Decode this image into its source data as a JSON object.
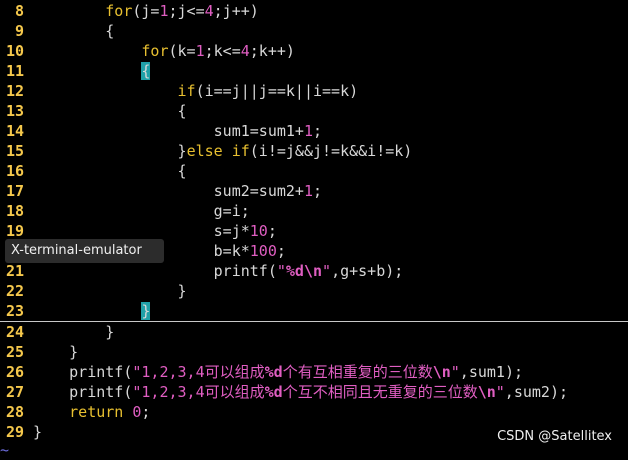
{
  "lines": [
    {
      "n": "8",
      "t": [
        [
          "        ",
          ""
        ],
        [
          "for",
          "kw"
        ],
        [
          "(j=",
          ""
        ],
        [
          "1",
          "num"
        ],
        [
          ";j<=",
          ""
        ],
        [
          "4",
          "num"
        ],
        [
          ";j++)",
          ""
        ]
      ]
    },
    {
      "n": "9",
      "t": [
        [
          "        {",
          ""
        ]
      ]
    },
    {
      "n": "10",
      "t": [
        [
          "            ",
          ""
        ],
        [
          "for",
          "kw"
        ],
        [
          "(k=",
          ""
        ],
        [
          "1",
          "num"
        ],
        [
          ";k<=",
          ""
        ],
        [
          "4",
          "num"
        ],
        [
          ";k++)",
          ""
        ]
      ]
    },
    {
      "n": "11",
      "t": [
        [
          "            ",
          ""
        ],
        [
          "{",
          "brace-hl"
        ]
      ]
    },
    {
      "n": "12",
      "t": [
        [
          "                ",
          ""
        ],
        [
          "if",
          "kw"
        ],
        [
          "(i==j||j==k||i==k)",
          ""
        ]
      ]
    },
    {
      "n": "13",
      "t": [
        [
          "                {",
          ""
        ]
      ]
    },
    {
      "n": "14",
      "t": [
        [
          "                    sum1=sum1+",
          ""
        ],
        [
          "1",
          "num"
        ],
        [
          ";",
          ""
        ]
      ]
    },
    {
      "n": "15",
      "t": [
        [
          "                }",
          ""
        ],
        [
          "else",
          "kw"
        ],
        [
          " ",
          ""
        ],
        [
          "if",
          "kw"
        ],
        [
          "(i!=j&&j!=k&&i!=k)",
          ""
        ]
      ]
    },
    {
      "n": "16",
      "t": [
        [
          "                {",
          ""
        ]
      ]
    },
    {
      "n": "17",
      "t": [
        [
          "                    sum2=sum2+",
          ""
        ],
        [
          "1",
          "num"
        ],
        [
          ";",
          ""
        ]
      ]
    },
    {
      "n": "18",
      "t": [
        [
          "                    g=i;",
          ""
        ]
      ]
    },
    {
      "n": "19",
      "t": [
        [
          "                    s=j*",
          ""
        ],
        [
          "10",
          "num"
        ],
        [
          ";",
          ""
        ]
      ]
    },
    {
      "n": "20",
      "t": [
        [
          "                    b=k*",
          ""
        ],
        [
          "100",
          "num"
        ],
        [
          ";",
          ""
        ]
      ]
    },
    {
      "n": "21",
      "t": [
        [
          "                    printf(",
          ""
        ],
        [
          "\"",
          "str"
        ],
        [
          "%d",
          "esc"
        ],
        [
          "\\n",
          "esc"
        ],
        [
          "\"",
          "str"
        ],
        [
          ",g+s+b);",
          ""
        ]
      ]
    },
    {
      "n": "22",
      "t": [
        [
          "                }",
          ""
        ]
      ]
    },
    {
      "n": "23",
      "t": [
        [
          "            ",
          ""
        ],
        [
          "}",
          "brace-hl"
        ]
      ],
      "cursorline": true
    },
    {
      "n": "24",
      "t": [
        [
          "        }",
          ""
        ]
      ]
    },
    {
      "n": "25",
      "t": [
        [
          "    }",
          ""
        ]
      ]
    },
    {
      "n": "26",
      "t": [
        [
          "    printf(",
          ""
        ],
        [
          "\"1,2,3,4可以组成",
          "str"
        ],
        [
          "%d",
          "esc"
        ],
        [
          "个有互相重复的三位数",
          "str"
        ],
        [
          "\\n",
          "esc"
        ],
        [
          "\"",
          "str"
        ],
        [
          ",sum1);",
          ""
        ]
      ]
    },
    {
      "n": "27",
      "t": [
        [
          "    printf(",
          ""
        ],
        [
          "\"1,2,3,4可以组成",
          "str"
        ],
        [
          "%d",
          "esc"
        ],
        [
          "个互不相同且无重复的三位数",
          "str"
        ],
        [
          "\\n",
          "esc"
        ],
        [
          "\"",
          "str"
        ],
        [
          ",sum2);",
          ""
        ]
      ]
    },
    {
      "n": "28",
      "t": [
        [
          "    ",
          ""
        ],
        [
          "return",
          "kw"
        ],
        [
          " ",
          ""
        ],
        [
          "0",
          "num"
        ],
        [
          ";",
          ""
        ]
      ]
    },
    {
      "n": "29",
      "t": [
        [
          "}",
          ""
        ]
      ]
    }
  ],
  "tooltip": "X-terminal-emulator",
  "watermark": "CSDN @Satellitex",
  "end_marker": "~",
  "colors": {
    "background": "#000000",
    "keyword": "#e8c030",
    "string": "#e05ec2",
    "brace_match": "#20a0a8",
    "line_number": "#f5c84c"
  }
}
